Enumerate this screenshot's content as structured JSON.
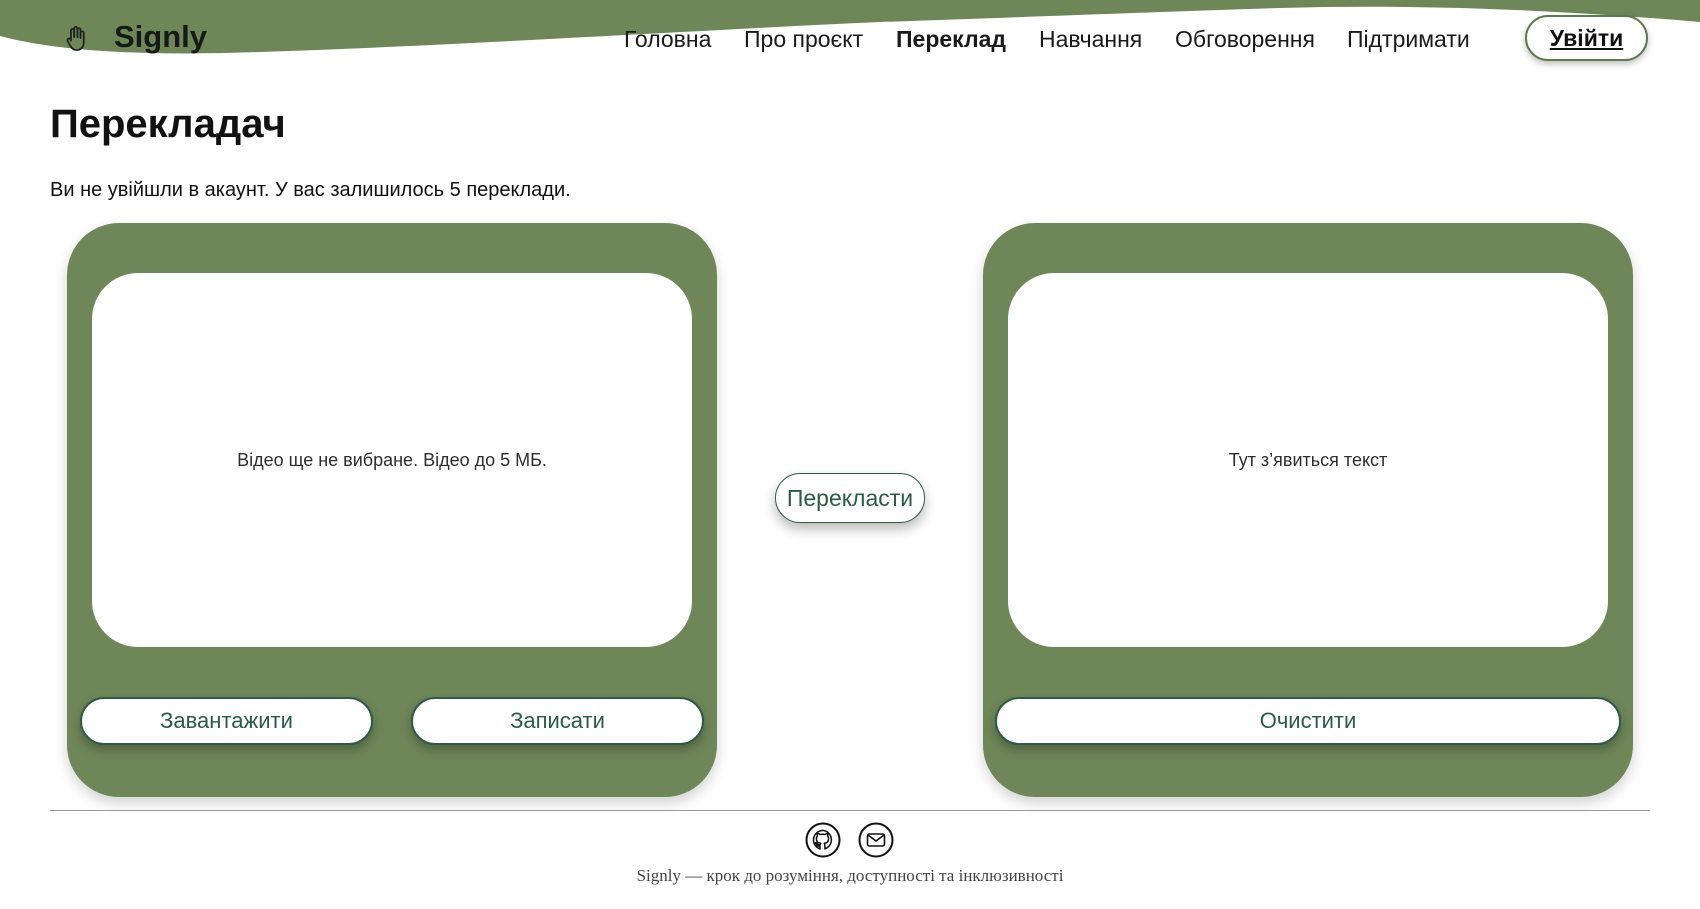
{
  "header": {
    "brand": "Signly",
    "logo_icon": "hand-icon",
    "nav": [
      {
        "label": "Головна",
        "active": false
      },
      {
        "label": "Про проєкт",
        "active": false
      },
      {
        "label": "Переклад",
        "active": true
      },
      {
        "label": "Навчання",
        "active": false
      },
      {
        "label": "Обговорення",
        "active": false
      },
      {
        "label": "Підтримати",
        "active": false
      }
    ],
    "login_label": "Увійти"
  },
  "main": {
    "title": "Перекладач",
    "notice": "Ви не увійшли в акаунт. У вас залишилось 5 переклади.",
    "video_panel": {
      "placeholder": "Відео ще не вибране. Відео до 5 МБ.",
      "upload_label": "Завантажити",
      "record_label": "Записати"
    },
    "translate_label": "Перекласти",
    "text_panel": {
      "placeholder": "Тут з’явиться текст",
      "clear_label": "Очистити"
    }
  },
  "footer": {
    "icons": [
      "github-icon",
      "mail-icon"
    ],
    "tagline": "Signly — крок до розуміння, доступності та інклюзивності"
  },
  "colors": {
    "accent_green": "#6f8659",
    "button_text": "#2a5c47",
    "border_green": "#2e5a46"
  }
}
